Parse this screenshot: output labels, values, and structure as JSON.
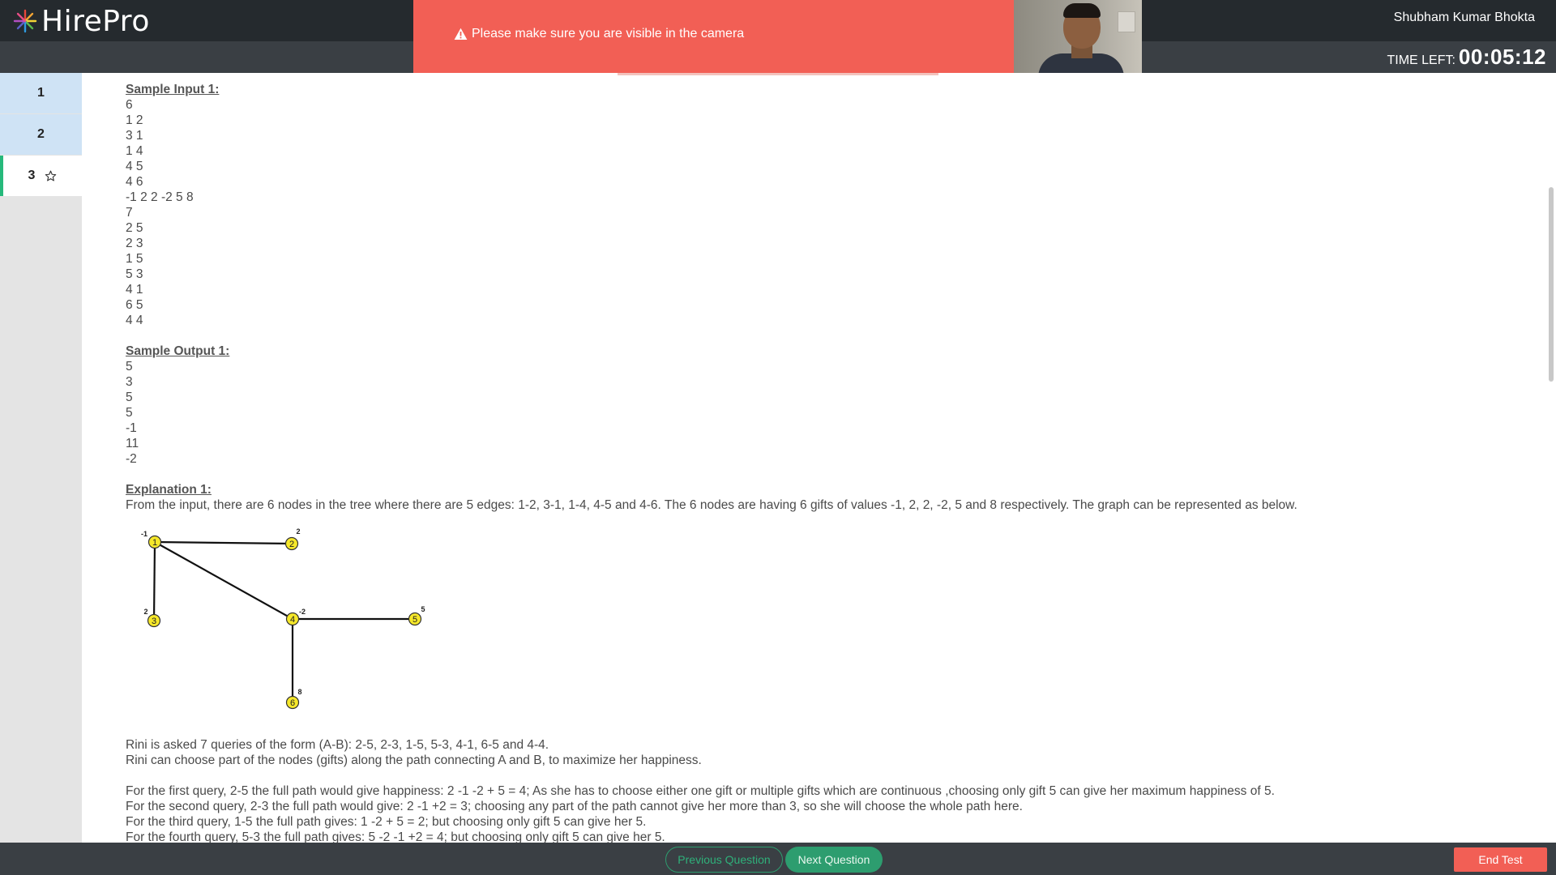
{
  "app": {
    "logo_text": "HirePro",
    "user_name": "Shubham Kumar Bhokta"
  },
  "timer": {
    "label": "TIME LEFT:",
    "value": "00:05:12"
  },
  "alert": {
    "message": "Please make sure you are visible in the camera"
  },
  "sidebar": {
    "questions": [
      {
        "label": "1",
        "state": "answered"
      },
      {
        "label": "2",
        "state": "answered"
      },
      {
        "label": "3",
        "state": "current"
      }
    ]
  },
  "content": {
    "sample_input_heading": "Sample Input 1:",
    "sample_input_lines": [
      "6",
      "1 2",
      "3 1",
      "1 4",
      "4 5",
      "4 6",
      "-1 2 2 -2 5 8",
      "7",
      "2 5",
      "2 3",
      "1 5",
      "5 3",
      "4 1",
      "6 5",
      "4 4"
    ],
    "sample_output_heading": "Sample Output 1:",
    "sample_output_lines": [
      "5",
      "3",
      "5",
      "5",
      "-1",
      "11",
      "-2"
    ],
    "explanation_heading": "Explanation 1:",
    "explanation_intro": "From the input, there are 6 nodes in the tree where there are 5 edges: 1-2, 3-1, 1-4, 4-5 and 4-6. The 6 nodes are having 6 gifts of values -1, 2, 2, -2, 5 and 8 respectively. The graph can be represented as below.",
    "graph": {
      "nodes": [
        {
          "id": "1",
          "value": "-1"
        },
        {
          "id": "2",
          "value": "2"
        },
        {
          "id": "3",
          "value": "2"
        },
        {
          "id": "4",
          "value": "-2"
        },
        {
          "id": "5",
          "value": "5"
        },
        {
          "id": "6",
          "value": "8"
        }
      ],
      "edges": [
        [
          "1",
          "2"
        ],
        [
          "1",
          "3"
        ],
        [
          "1",
          "4"
        ],
        [
          "4",
          "5"
        ],
        [
          "4",
          "6"
        ]
      ],
      "node_color": "#f6e82a"
    },
    "queries_line": "Rini is asked 7 queries of the form (A-B): 2-5, 2-3, 1-5, 5-3, 4-1, 6-5 and 4-4.",
    "choose_line": "Rini can choose part of the nodes (gifts) along the path connecting A and B, to maximize her happiness.",
    "query_explanations": [
      "For the first query, 2-5 the full path would give happiness: 2 -1 -2 + 5 = 4; As she has to choose either one gift or multiple gifts which are continuous ,choosing only gift 5 can give her maximum happiness of 5.",
      "For the second query, 2-3 the full path would give: 2 -1 +2 = 3; choosing any part of the path cannot give her more than 3, so she will choose the whole path here.",
      "For the third query, 1-5 the full path gives: 1 -2 + 5 = 2; but choosing only gift 5 can give her 5.",
      "For the fourth query, 5-3 the full path gives: 5 -2 -1 +2 = 4; but choosing only gift 5 can give her 5."
    ]
  },
  "footer": {
    "prev_label": "Previous Question",
    "next_label": "Next Question",
    "end_label": "End Test"
  },
  "colors": {
    "topbar": "#252a2e",
    "subbar": "#3a3f44",
    "alert": "#f25f55",
    "accent_green": "#2d9d6f",
    "answered_blue": "#cfe3f5"
  }
}
